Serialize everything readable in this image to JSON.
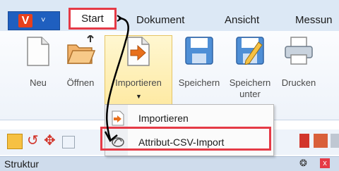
{
  "app_button": {
    "logo_letter": "V",
    "dropdown_glyph": "˅"
  },
  "tabs": [
    {
      "label": "Start"
    },
    {
      "label": "Dokument"
    },
    {
      "label": "Ansicht"
    },
    {
      "label": "Messun"
    }
  ],
  "ribbon": {
    "buttons": [
      {
        "label": "Neu",
        "icon": "new-document-icon"
      },
      {
        "label": "Öffnen",
        "icon": "open-folder-icon"
      },
      {
        "label": "Importieren",
        "icon": "import-icon"
      },
      {
        "label": "Speichern",
        "icon": "save-icon"
      },
      {
        "label": "Speichern",
        "label2": "unter",
        "icon": "save-as-icon"
      },
      {
        "label": "Drucken",
        "icon": "print-icon"
      }
    ]
  },
  "dropdown": {
    "items": [
      {
        "label": "Importieren",
        "icon": "import-icon"
      },
      {
        "label": "Attribut-CSV-Import",
        "icon": "csv-import-icon"
      }
    ]
  },
  "panel": {
    "title": "Struktur",
    "pin_glyph": "❂",
    "close_glyph": "x"
  },
  "colors": {
    "highlight_red": "#e53a46",
    "ribbon_blue": "#dce8f5",
    "app_blue": "#1f5fbf",
    "accent_orange": "#e8701c"
  }
}
